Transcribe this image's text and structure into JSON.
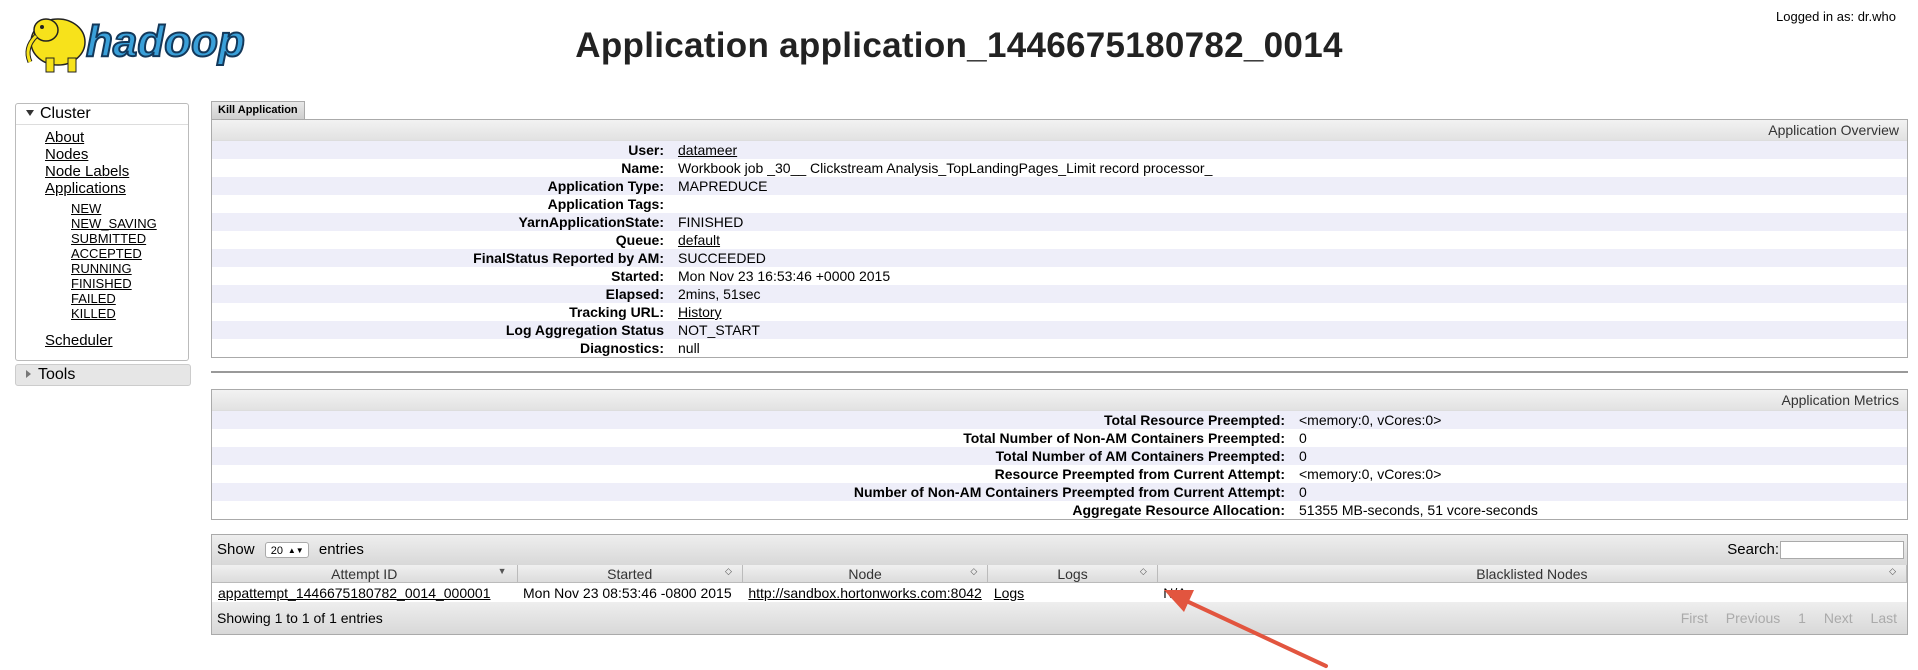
{
  "header": {
    "logo_text": "hadoop",
    "logged_in": "Logged in as: dr.who",
    "title": "Application application_1446675180782_0014"
  },
  "sidebar": {
    "cluster_label": "Cluster",
    "items": [
      "About",
      "Nodes",
      "Node Labels",
      "Applications"
    ],
    "app_states": [
      "NEW",
      "NEW_SAVING",
      "SUBMITTED",
      "ACCEPTED",
      "RUNNING",
      "FINISHED",
      "FAILED",
      "KILLED"
    ],
    "scheduler_label": "Scheduler",
    "tools_label": "Tools"
  },
  "kill_tab": "Kill Application",
  "overview": {
    "title": "Application Overview",
    "rows": [
      {
        "k": "User:",
        "v": "datameer"
      },
      {
        "k": "Name:",
        "v": "Workbook job _30__ Clickstream Analysis_TopLandingPages_Limit record processor_"
      },
      {
        "k": "Application Type:",
        "v": "MAPREDUCE"
      },
      {
        "k": "Application Tags:",
        "v": ""
      },
      {
        "k": "YarnApplicationState:",
        "v": "FINISHED"
      },
      {
        "k": "Queue:",
        "v": "default"
      },
      {
        "k": "FinalStatus Reported by AM:",
        "v": "SUCCEEDED"
      },
      {
        "k": "Started:",
        "v": "Mon Nov 23 16:53:46 +0000 2015"
      },
      {
        "k": "Elapsed:",
        "v": "2mins, 51sec"
      },
      {
        "k": "Tracking URL:",
        "v": "History"
      },
      {
        "k": "Log Aggregation Status",
        "v": "NOT_START"
      },
      {
        "k": "Diagnostics:",
        "v": "null"
      }
    ]
  },
  "metrics": {
    "title": "Application Metrics",
    "rows": [
      {
        "k": "Total Resource Preempted:",
        "v": "<memory:0, vCores:0>"
      },
      {
        "k": "Total Number of Non-AM Containers Preempted:",
        "v": "0"
      },
      {
        "k": "Total Number of AM Containers Preempted:",
        "v": "0"
      },
      {
        "k": "Resource Preempted from Current Attempt:",
        "v": "<memory:0, vCores:0>"
      },
      {
        "k": "Number of Non-AM Containers Preempted from Current Attempt:",
        "v": "0"
      },
      {
        "k": "Aggregate Resource Allocation:",
        "v": "51355 MB-seconds, 51 vcore-seconds"
      }
    ]
  },
  "attempts": {
    "show_label": "Show",
    "page_length": "20",
    "entries_label": "entries",
    "search_label": "Search:",
    "columns": [
      "Attempt ID",
      "Started",
      "Node",
      "Logs",
      "Blacklisted Nodes"
    ],
    "rows": [
      [
        "appattempt_1446675180782_0014_000001",
        "Mon Nov 23 08:53:46 -0800 2015",
        "http://sandbox.hortonworks.com:8042",
        "Logs",
        "N/A"
      ]
    ],
    "info": "Showing 1 to 1 of 1 entries",
    "pager": [
      "First",
      "Previous",
      "1",
      "Next",
      "Last"
    ]
  },
  "annotation_arrow_color": "#e2553f"
}
